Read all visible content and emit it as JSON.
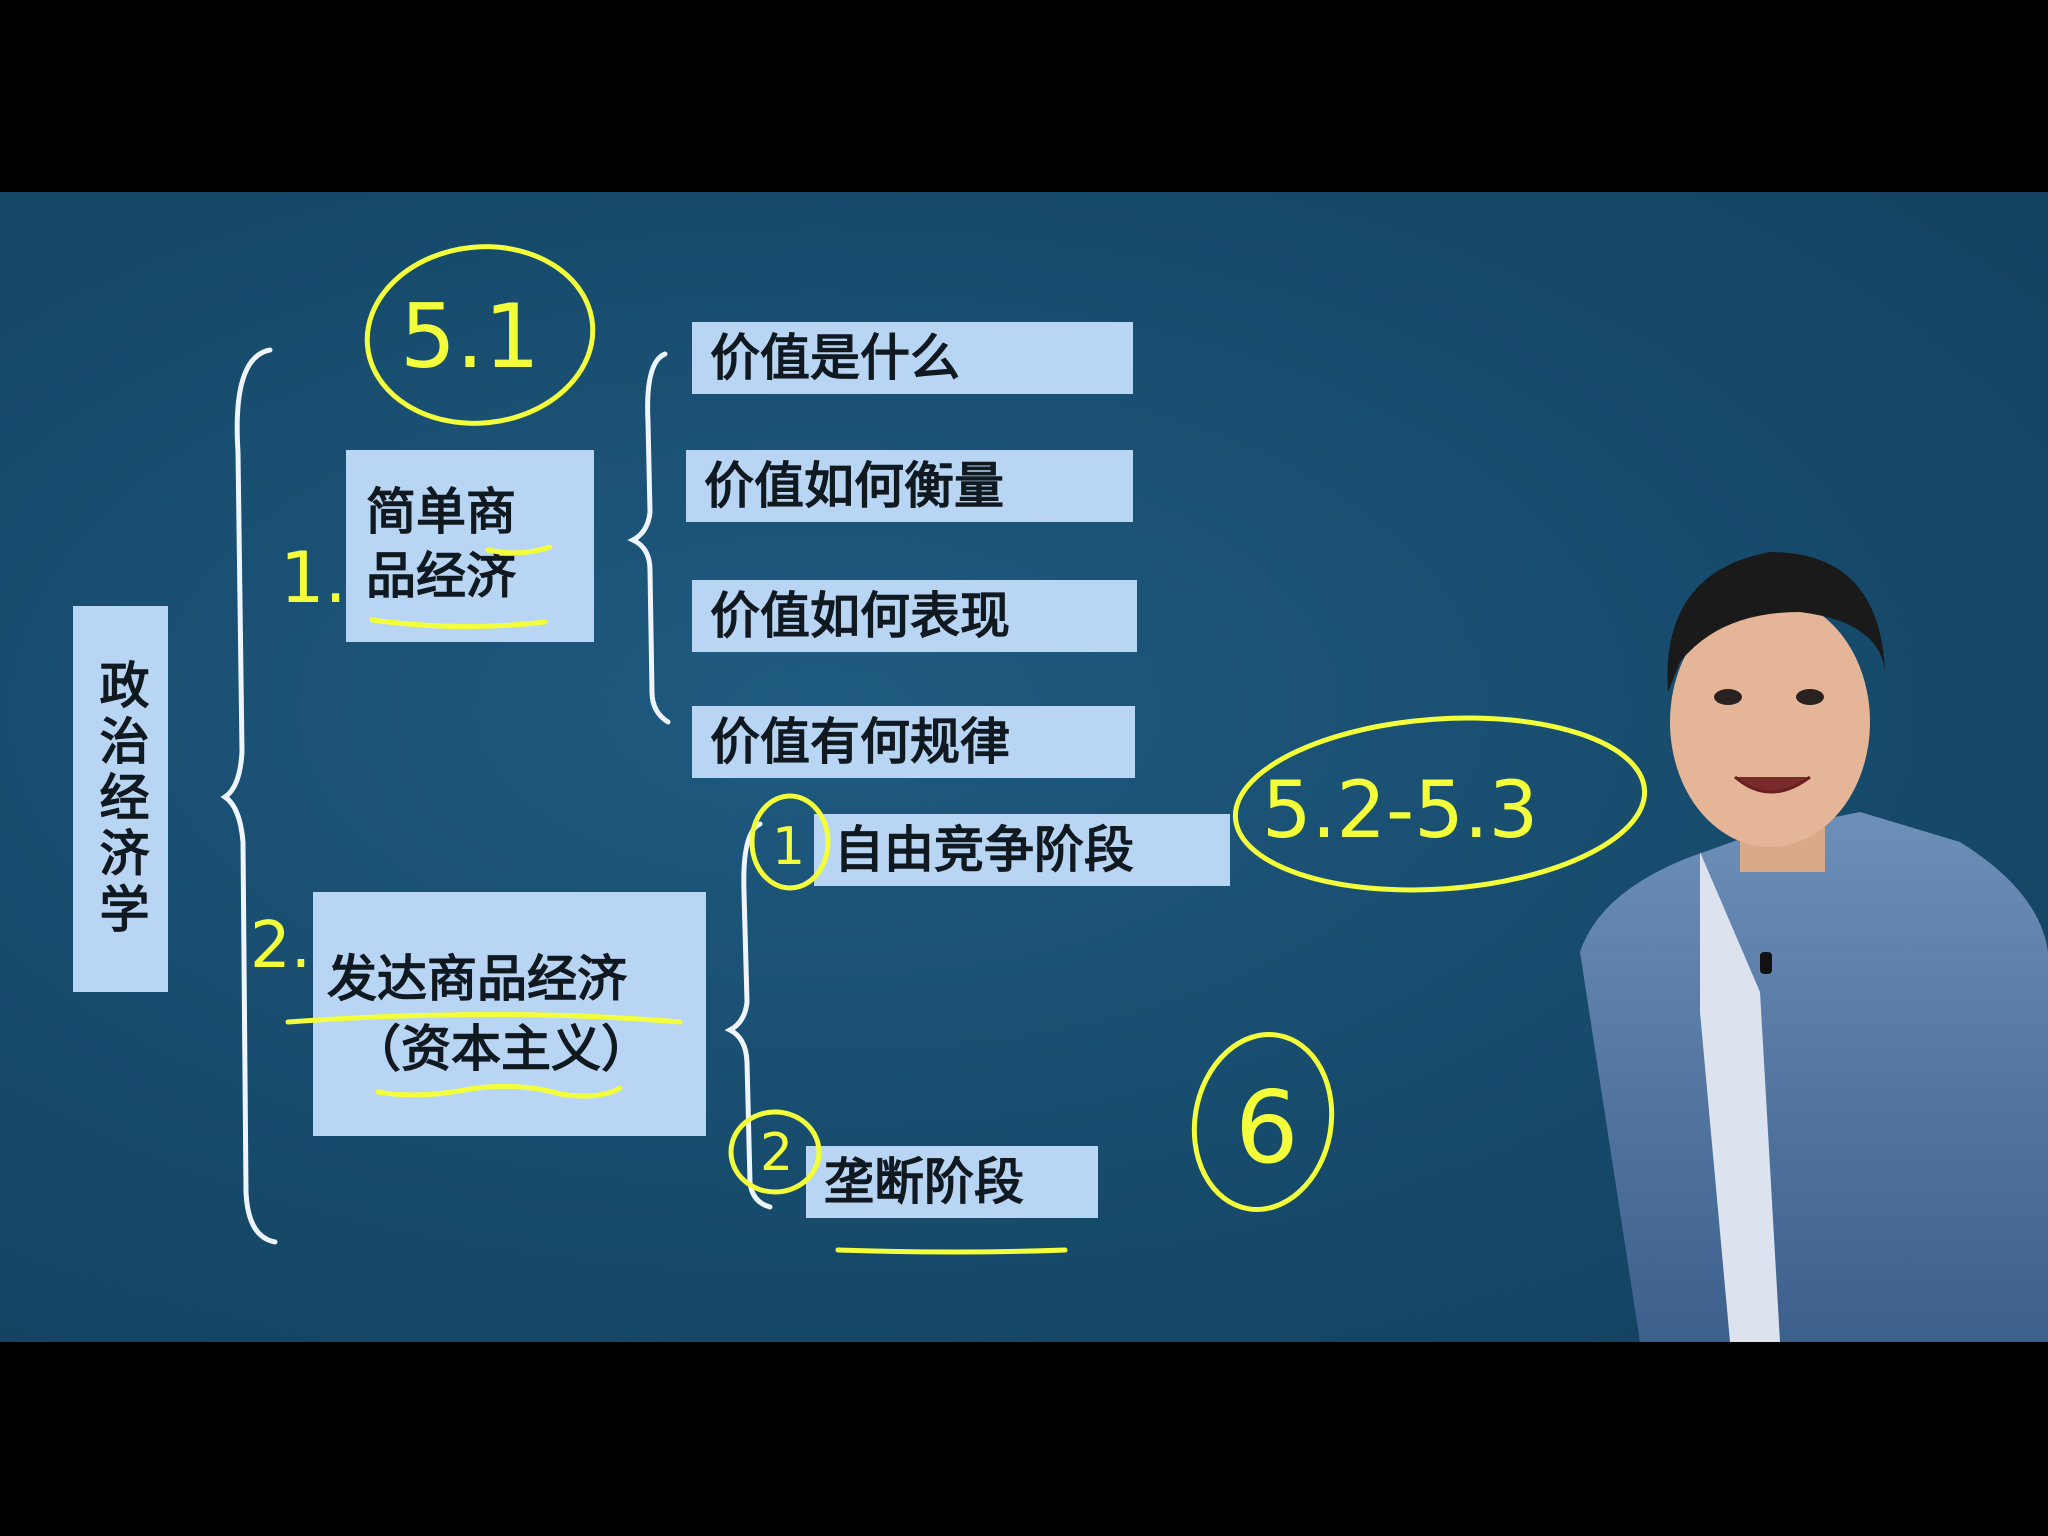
{
  "board": {
    "title": "政治经济学",
    "branch1": {
      "number": "1.",
      "circle_label": "5.1",
      "line1": "简单商",
      "line2": "品经济",
      "items": [
        "价值是什么",
        "价值如何衡量",
        "价值如何表现",
        "价值有何规律"
      ]
    },
    "branch2": {
      "number": "2.",
      "line1": "发达商品经济",
      "line2": "（资本主义）",
      "stages": [
        {
          "marker": "1",
          "label": "自由竞争阶段",
          "circle_label": "5.2-5.3"
        },
        {
          "marker": "2",
          "label": "垄断阶段",
          "circle_label": "6"
        }
      ]
    }
  },
  "colors": {
    "board": "#174b6c",
    "card": "#b9d5f4",
    "chalk": "#eef5ff",
    "highlighter": "#f2ff3a"
  }
}
